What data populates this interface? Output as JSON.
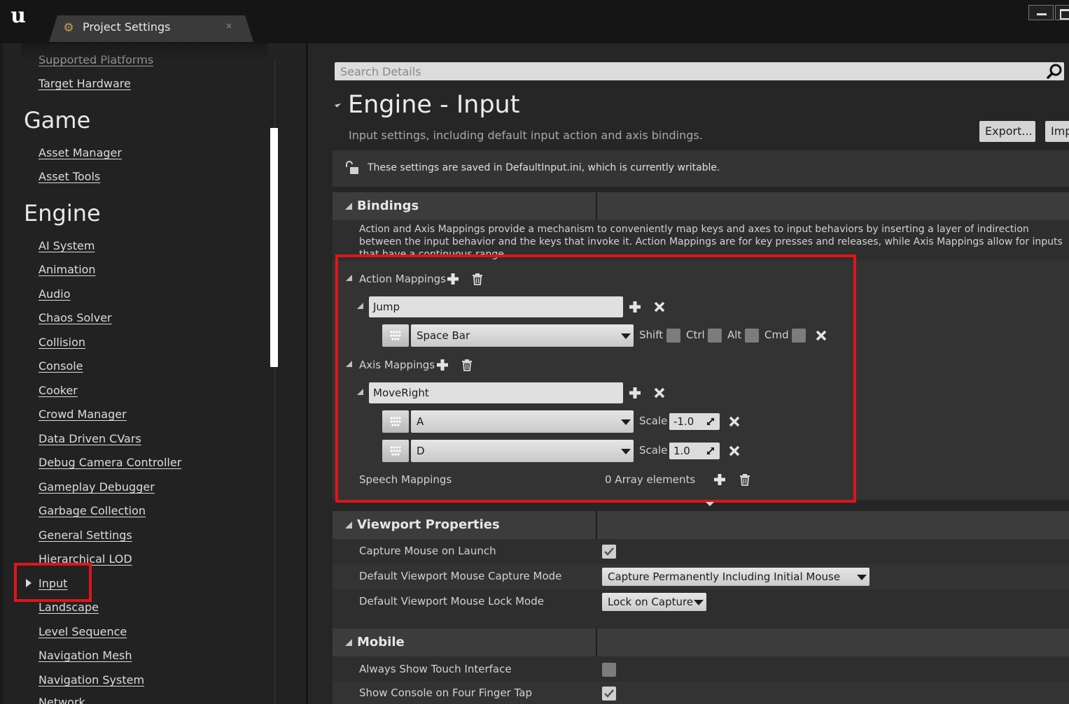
{
  "window": {
    "tab_title": "Project Settings",
    "tab_close": "×"
  },
  "sidebar": {
    "clipped_top_item": "Supported Platforms",
    "items_top": [
      "Target Hardware"
    ],
    "categories": [
      {
        "name": "Game",
        "items": [
          "Asset Manager",
          "Asset Tools"
        ]
      },
      {
        "name": "Engine",
        "items": [
          "AI System",
          "Animation",
          "Audio",
          "Chaos Solver",
          "Collision",
          "Console",
          "Cooker",
          "Crowd Manager",
          "Data Driven CVars",
          "Debug Camera Controller",
          "Gameplay Debugger",
          "Garbage Collection",
          "General Settings",
          "Hierarchical LOD",
          "Input",
          "Landscape",
          "Level Sequence",
          "Navigation Mesh",
          "Navigation System",
          "Network"
        ]
      }
    ],
    "selected_item": "Input"
  },
  "details": {
    "search_placeholder": "Search Details",
    "section_title": "Engine - Input",
    "section_description": "Input settings, including default input action and axis bindings.",
    "export_label": "Export...",
    "import_label": "Imp",
    "info_text": "These settings are saved in DefaultInput.ini, which is currently writable.",
    "bindings": {
      "title": "Bindings",
      "description": "Action and Axis Mappings provide a mechanism to conveniently map keys and axes to input behaviors by inserting a layer of indirection between the input behavior and the keys that invoke it. Action Mappings are for key presses and releases, while Axis Mappings allow for inputs that have a continuous range.",
      "action_mappings_label": "Action Mappings",
      "action_name": "Jump",
      "action_key": "Space Bar",
      "modifiers": {
        "shift": "Shift",
        "ctrl": "Ctrl",
        "alt": "Alt",
        "cmd": "Cmd"
      },
      "axis_mappings_label": "Axis Mappings",
      "axis_name": "MoveRight",
      "axis_keys": [
        {
          "key": "A",
          "scale_label": "Scale",
          "scale": "-1.0"
        },
        {
          "key": "D",
          "scale_label": "Scale",
          "scale": "1.0"
        }
      ],
      "speech_mappings_label": "Speech Mappings",
      "speech_mappings_value": "0 Array elements"
    },
    "viewport": {
      "title": "Viewport Properties",
      "capture_mouse_label": "Capture Mouse on Launch",
      "capture_mouse_checked": true,
      "capture_mode_label": "Default Viewport Mouse Capture Mode",
      "capture_mode_value": "Capture Permanently Including Initial Mouse Down",
      "lock_mode_label": "Default Viewport Mouse Lock Mode",
      "lock_mode_value": "Lock on Capture"
    },
    "mobile": {
      "title": "Mobile",
      "touch_label": "Always Show Touch Interface",
      "touch_checked": false,
      "console_label": "Show Console on Four Finger Tap",
      "console_checked": true
    }
  },
  "colors": {
    "highlight": "#e0141b"
  }
}
